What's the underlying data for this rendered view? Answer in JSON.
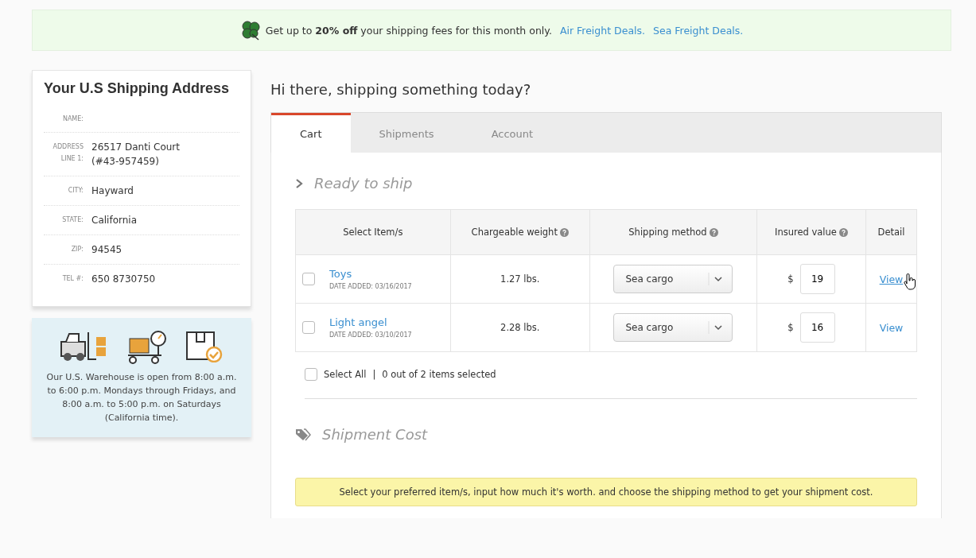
{
  "banner": {
    "text": "Get up to **20% off** your shipping fees for this month only.",
    "links": [
      "Air Freight Deals.",
      "Sea Freight Deals."
    ]
  },
  "address": {
    "title": "Your U.S Shipping Address",
    "fields": [
      {
        "label": "NAME:"
      },
      {
        "label": "ADDRESS LINE 1:",
        "value": "26517 Danti Court (#43-957459)"
      },
      {
        "label": "CITY:",
        "value": "Hayward"
      },
      {
        "label": "STATE:",
        "value": "California"
      },
      {
        "label": "ZIP:",
        "value": "94545"
      },
      {
        "label": "TEL #:",
        "value": "650 8730750"
      }
    ]
  },
  "warehouse": {
    "text": "Our U.S. Warehouse is open from 8:00 a.m. to 6:00 p.m. Mondays through Fridays, and 8:00 a.m. to 5:00 p.m. on Saturdays (California time)."
  },
  "greeting": "Hi there, shipping something today?",
  "tabs": [
    {
      "label": "Cart",
      "selected": true
    },
    {
      "label": "Shipments",
      "selected": false
    },
    {
      "label": "Account",
      "selected": false
    }
  ],
  "ready": {
    "title": "Ready to ship"
  },
  "table": {
    "columns": [
      {
        "label": "Select Item/s",
        "help": false
      },
      {
        "label": "Chargeable weight",
        "help": true
      },
      {
        "label": "Shipping method",
        "help": true
      },
      {
        "label": "Insured value",
        "help": true
      },
      {
        "label": "Detail",
        "help": false
      }
    ],
    "rows": [
      {
        "name": "Toys",
        "date": "DATE ADDED: 03/16/2017",
        "checked": false,
        "weight": "1.27 lbs.",
        "method": "Sea cargo",
        "currency": "$",
        "value": "19",
        "link": "View",
        "hovered": true
      },
      {
        "name": "Light angel",
        "date": "DATE ADDED: 03/10/2017",
        "checked": false,
        "weight": "2.28 lbs.",
        "method": "Sea cargo",
        "currency": "$",
        "value": "16",
        "link": "View",
        "hovered": false
      }
    ]
  },
  "select_all": {
    "label": "Select All",
    "checked": false,
    "separator": "|",
    "count": "0 out of 2 items selected"
  },
  "cost": {
    "title": "Shipment Cost",
    "notice": "Select your preferred item/s, input how much it's worth. and choose the shipping method to get your shipment cost."
  }
}
